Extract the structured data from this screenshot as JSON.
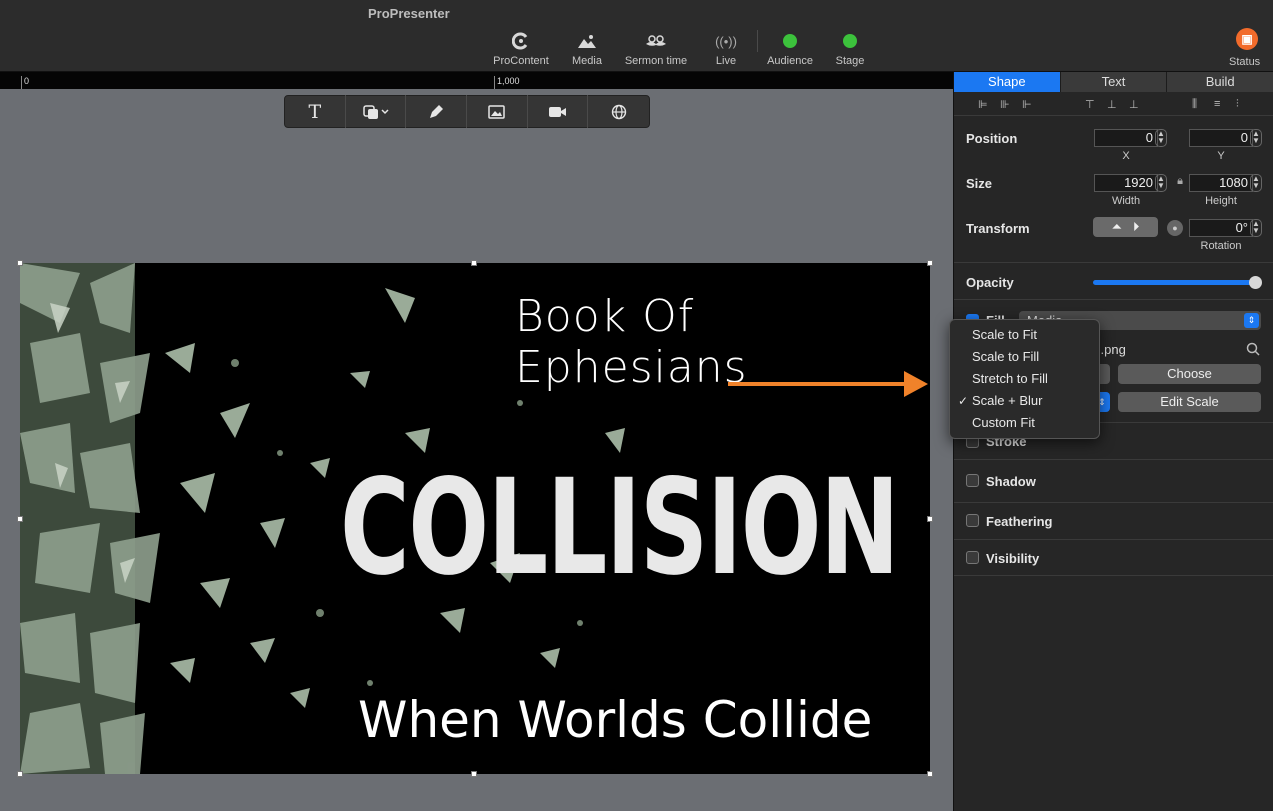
{
  "app": {
    "title": "ProPresenter"
  },
  "toolbar": {
    "items": [
      {
        "label": "ProContent",
        "icon": "procontent-icon"
      },
      {
        "label": "Media",
        "icon": "media-icon"
      },
      {
        "label": "Sermon time",
        "icon": "mustache-icon"
      },
      {
        "label": "Live",
        "icon": "broadcast-icon"
      },
      {
        "label": "Audience",
        "icon": "green-dot-icon"
      },
      {
        "label": "Stage",
        "icon": "green-dot-icon"
      }
    ],
    "status_label": "Status",
    "status_color": "#f26b2b",
    "indicator_color": "#3cc23c"
  },
  "ruler": {
    "labels": [
      "0",
      "1,000"
    ]
  },
  "editor_tools": [
    "text-tool",
    "shape-tool",
    "pen-tool",
    "image-tool",
    "video-tool",
    "web-tool"
  ],
  "slide": {
    "subtitle": "Book Of Ephesians",
    "title": "COLLISION",
    "footer": "When Worlds Collide"
  },
  "inspector": {
    "tabs": [
      "Shape",
      "Text",
      "Build"
    ],
    "active_tab": "Shape",
    "position": {
      "label": "Position",
      "x": "0",
      "y": "0",
      "x_label": "X",
      "y_label": "Y"
    },
    "size": {
      "label": "Size",
      "width": "1920",
      "height": "1080",
      "width_label": "Width",
      "height_label": "Height"
    },
    "transform": {
      "label": "Transform",
      "rotation": "0°",
      "rotation_label": "Rotation"
    },
    "opacity": {
      "label": "Opacity",
      "value": 1.0
    },
    "fill": {
      "label": "Fill",
      "type": "Media",
      "file": "s.png",
      "choose_label": "Choose",
      "edit_scale_label": "Edit Scale"
    },
    "sections": [
      "Stroke",
      "Shadow",
      "Feathering",
      "Visibility"
    ]
  },
  "scale_menu": {
    "options": [
      "Scale to Fit",
      "Scale to Fill",
      "Stretch to Fill",
      "Scale + Blur",
      "Custom Fit"
    ],
    "selected": "Scale + Blur"
  },
  "accent_color": "#1b78f2",
  "arrow_color": "#f0822a"
}
